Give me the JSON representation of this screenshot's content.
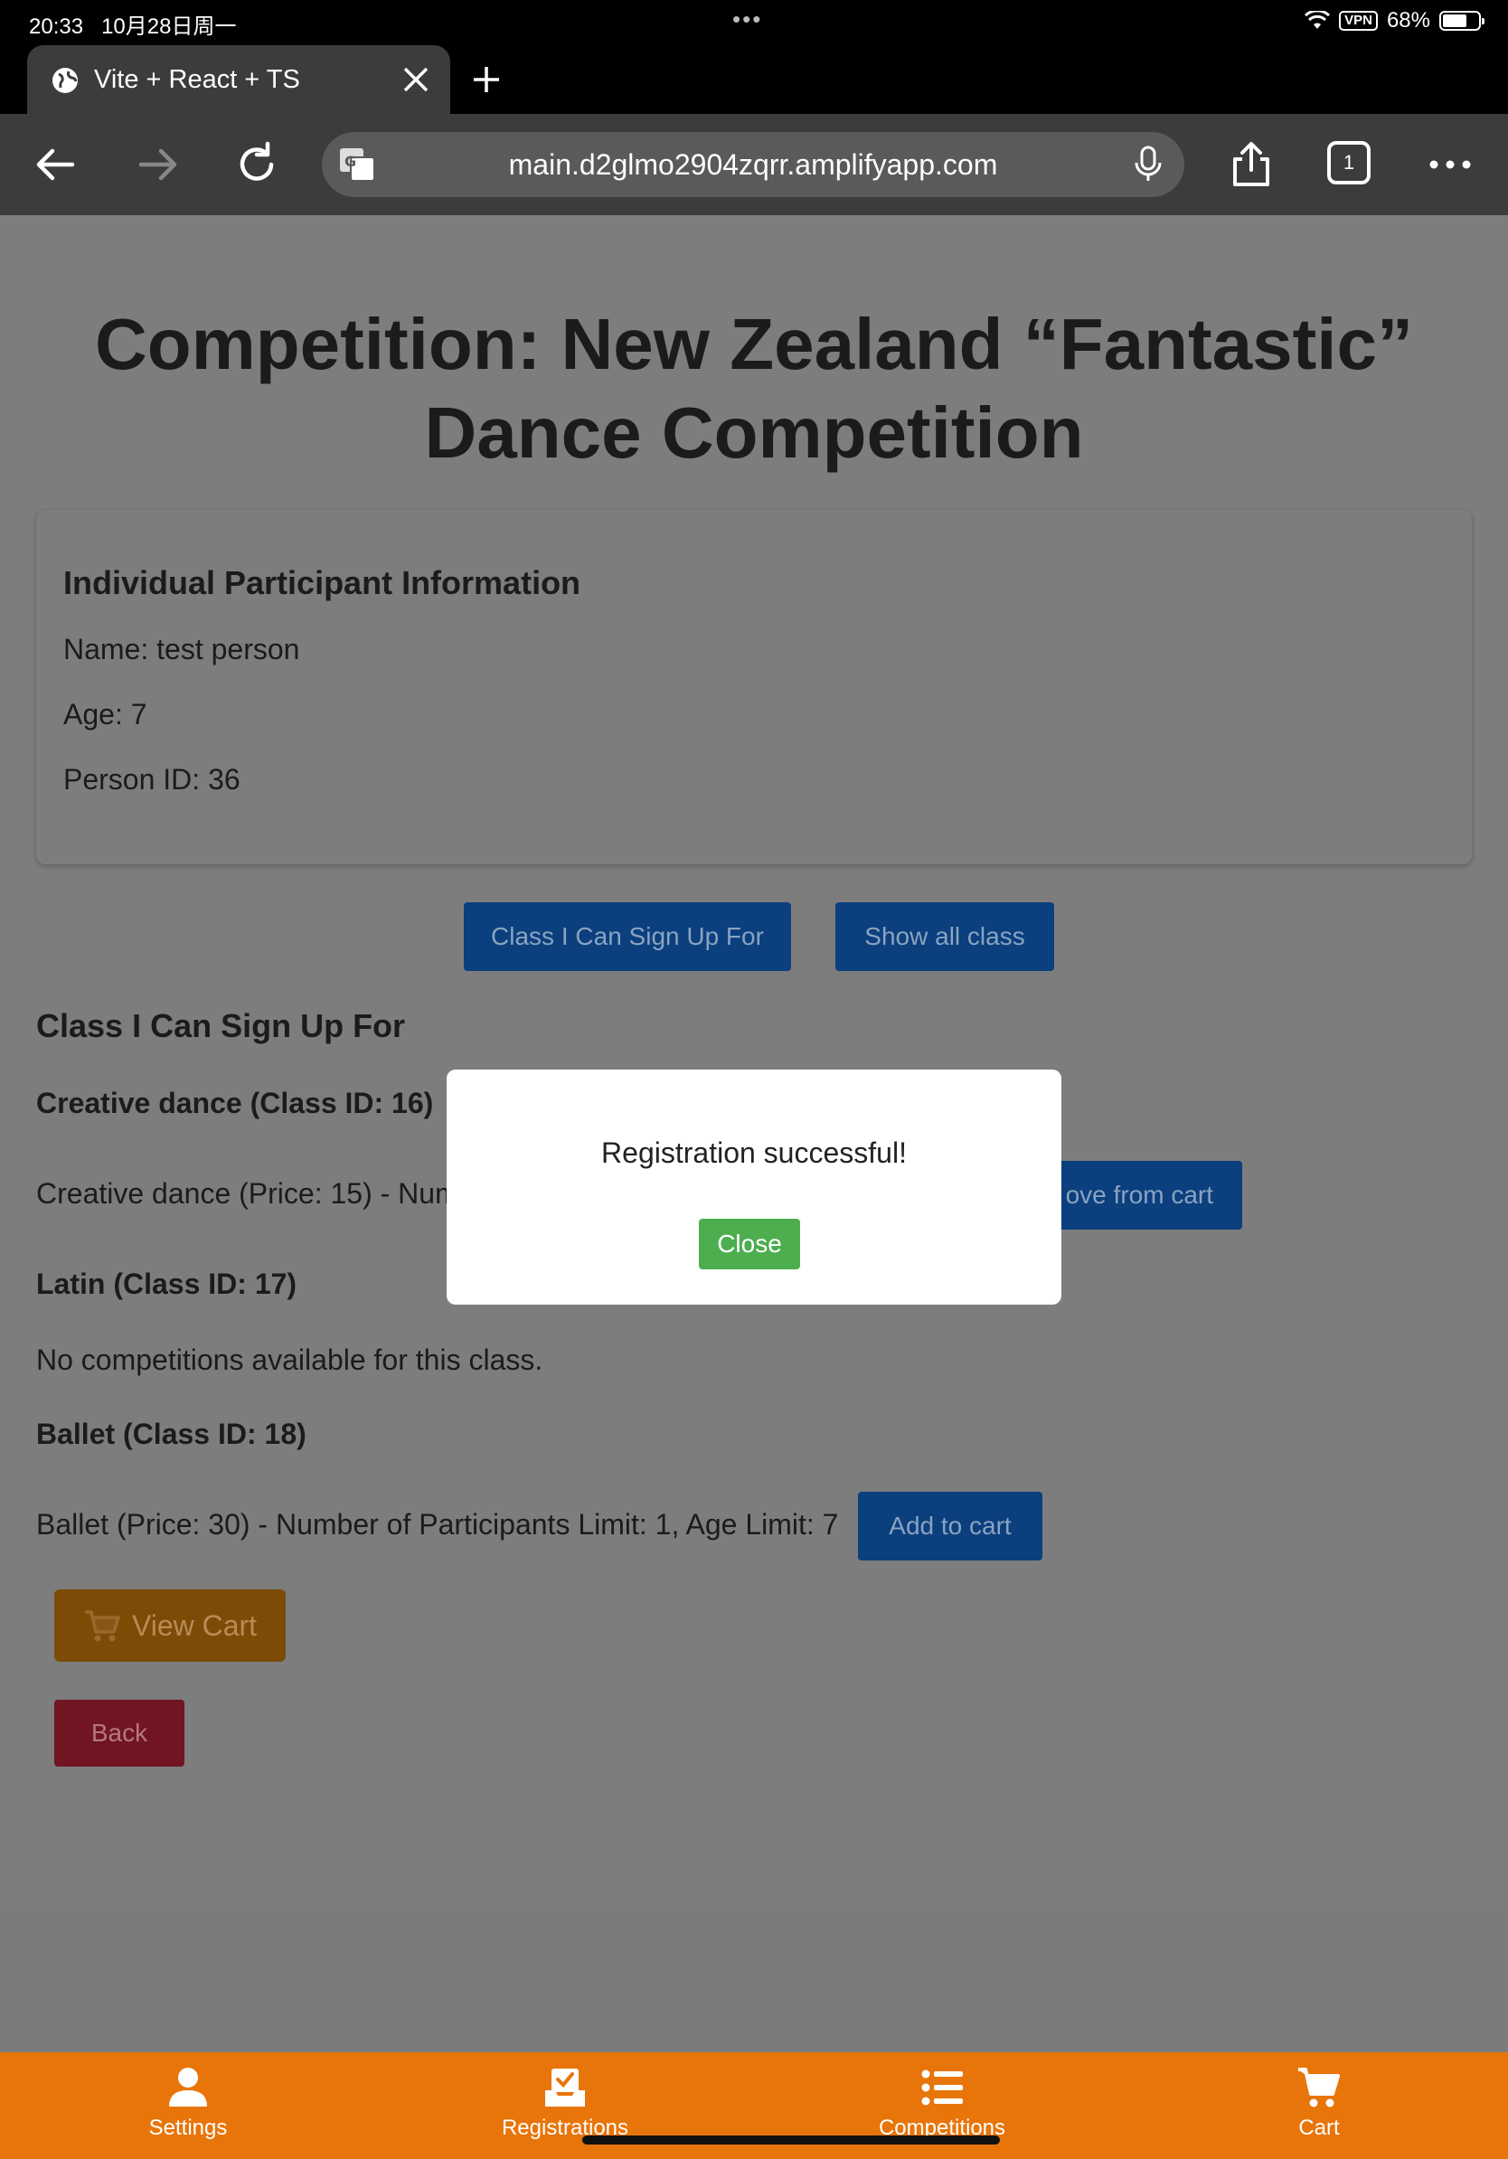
{
  "status_bar": {
    "time": "20:33",
    "date": "10月28日周一",
    "vpn": "VPN",
    "battery": "68%",
    "battery_level": 0.68
  },
  "browser": {
    "tab_title": "Vite + React + TS",
    "url": "main.d2glmo2904zqrr.amplifyapp.com",
    "tab_count": "1"
  },
  "page": {
    "title": "Competition: New Zealand “Fantastic” Dance Competition",
    "participant": {
      "heading": "Individual Participant Information",
      "name": "Name: test person",
      "age": "Age: 7",
      "person_id": "Person ID: 36"
    },
    "buttons": {
      "signup": "Class I Can Sign Up For",
      "show_all": "Show all class"
    },
    "section_title": "Class I Can Sign Up For",
    "classes": [
      {
        "title": "Creative dance (Class ID: 16)",
        "line": "Creative dance (Price: 15) - Num",
        "action": "ove from cart"
      },
      {
        "title": "Latin (Class ID: 17)",
        "line": "No competitions available for this class."
      },
      {
        "title": "Ballet (Class ID: 18)",
        "line": "Ballet (Price: 30) - Number of Participants Limit: 1, Age Limit: 7",
        "action": "Add to cart"
      }
    ],
    "view_cart": "View Cart",
    "back": "Back"
  },
  "modal": {
    "message": "Registration successful!",
    "close": "Close"
  },
  "bottom_nav": [
    {
      "label": "Settings",
      "icon": "person-icon"
    },
    {
      "label": "Registrations",
      "icon": "inbox-check-icon"
    },
    {
      "label": "Competitions",
      "icon": "list-icon"
    },
    {
      "label": "Cart",
      "icon": "cart-icon"
    }
  ],
  "colors": {
    "nav": "#e8750a",
    "primary": "#0b3f7e",
    "success": "#4cae4f",
    "danger": "#711523",
    "warning": "#7c4b06"
  }
}
